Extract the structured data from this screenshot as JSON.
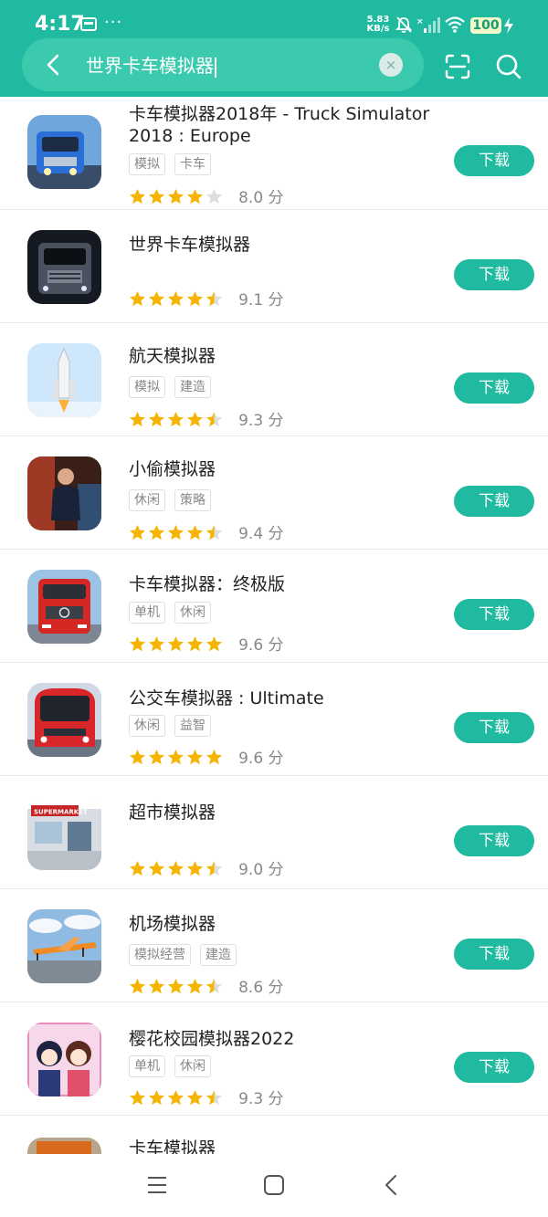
{
  "status_bar": {
    "time": "4:17",
    "more": "···",
    "net_speed_value": "5.83",
    "net_speed_unit": "KB/s",
    "battery": "100"
  },
  "search": {
    "query": "世界卡车模拟器",
    "clear": "×"
  },
  "labels": {
    "download": "下载",
    "score_suffix": "分"
  },
  "colors": {
    "accent": "#1fba9f",
    "star": "#f5b400",
    "star_empty": "#dddddd"
  },
  "apps": [
    {
      "title": "卡车模拟器2018年 - Truck Simulator",
      "title_line2": "2018 : Europe",
      "tags": [
        "模拟",
        "卡车"
      ],
      "rating": 4,
      "score": "8.0 分",
      "icon": "blue-truck-app-icon"
    },
    {
      "title": "世界卡车模拟器",
      "title_line2": "",
      "tags": [],
      "rating": 4.5,
      "score": "9.1 分",
      "icon": "dark-truck-app-icon"
    },
    {
      "title": "航天模拟器",
      "title_line2": "",
      "tags": [
        "模拟",
        "建造"
      ],
      "rating": 4.5,
      "score": "9.3 分",
      "icon": "rocket-app-icon"
    },
    {
      "title": "小偷模拟器",
      "title_line2": "",
      "tags": [
        "休闲",
        "策略"
      ],
      "rating": 4.5,
      "score": "9.4 分",
      "icon": "thief-app-icon"
    },
    {
      "title": "卡车模拟器：终极版",
      "title_line2": "",
      "tags": [
        "单机",
        "休闲"
      ],
      "rating": 5,
      "score": "9.6 分",
      "icon": "red-truck-app-icon"
    },
    {
      "title": "公交车模拟器 : Ultimate",
      "title_line2": "",
      "tags": [
        "休闲",
        "益智"
      ],
      "rating": 5,
      "score": "9.6 分",
      "icon": "bus-app-icon"
    },
    {
      "title": "超市模拟器",
      "title_line2": "",
      "tags": [],
      "rating": 4.5,
      "score": "9.0 分",
      "icon": "supermarket-app-icon",
      "icon_text": "SUPERMARKET"
    },
    {
      "title": "机场模拟器",
      "title_line2": "",
      "tags": [
        "模拟经营",
        "建造"
      ],
      "rating": 4.5,
      "score": "8.6 分",
      "icon": "airplane-app-icon"
    },
    {
      "title": "樱花校园模拟器2022",
      "title_line2": "",
      "tags": [
        "单机",
        "休闲"
      ],
      "rating": 4.5,
      "score": "9.3 分",
      "icon": "anime-school-app-icon"
    },
    {
      "title": "卡车模拟器",
      "title_line2": "",
      "tags": [],
      "rating": 0,
      "score": "",
      "icon": "orange-truck-app-icon"
    }
  ]
}
